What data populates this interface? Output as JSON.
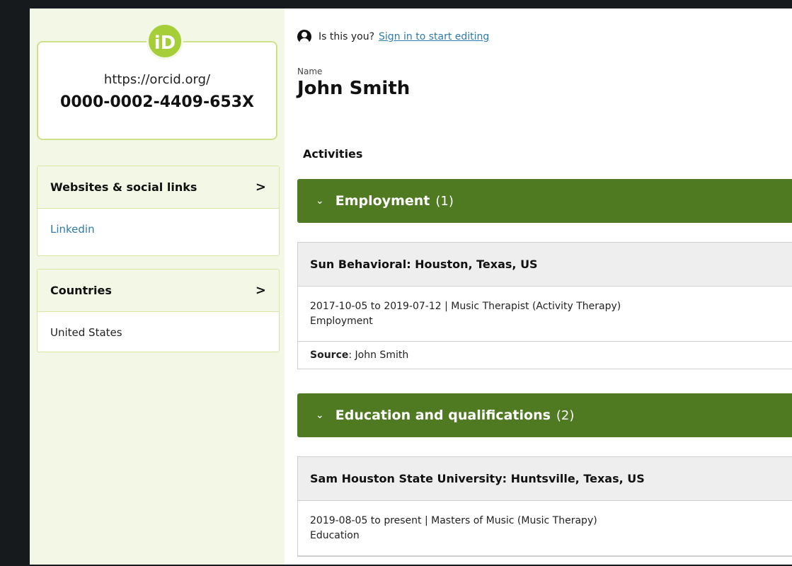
{
  "sidebar": {
    "orcid": {
      "logo": "iD",
      "url": "https://orcid.org/",
      "id": "0000-0002-4409-653X"
    },
    "websites": {
      "title": "Websites & social links",
      "link": "Linkedin"
    },
    "countries": {
      "title": "Countries",
      "value": "United States"
    }
  },
  "main": {
    "signin": {
      "prompt": "Is this you?",
      "link": "Sign in to start editing"
    },
    "name": {
      "label": "Name",
      "value": "John Smith"
    },
    "activities_label": "Activities",
    "employment": {
      "title": "Employment",
      "count": "(1)",
      "item": {
        "org": "Sun Behavioral: Houston, Texas, US",
        "dates_role": "2017-10-05 to 2019-07-12 | Music Therapist (Activity Therapy)",
        "type": "Employment",
        "source_label": "Source",
        "source_value": ": John Smith"
      }
    },
    "education": {
      "title": "Education and qualifications",
      "count": "(2)",
      "item": {
        "org": "Sam Houston State University: Huntsville, Texas, US",
        "dates_role": "2019-08-05 to present | Masters of Music (Music Therapy)",
        "type": "Education"
      }
    }
  },
  "icons": {
    "chevron_right": "›",
    "chevron_down": "⌄"
  },
  "colors": {
    "accent_green": "#4f7a22",
    "orcid_green": "#a6ce39",
    "sidebar_bg": "#f3f7e6",
    "link_blue": "#2e7bab"
  }
}
